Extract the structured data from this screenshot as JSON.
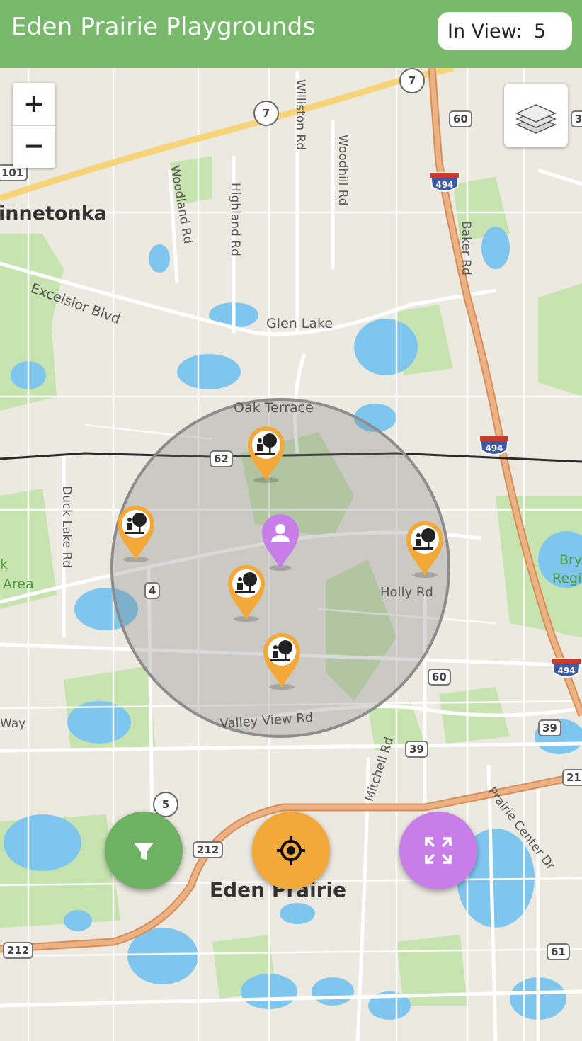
{
  "app": {
    "title": "Eden Prairie Playgrounds"
  },
  "in_view": {
    "label": "In View:",
    "count": "5"
  },
  "map_controls": {
    "zoom_in": "+",
    "zoom_out": "−"
  },
  "map_labels": {
    "innetonka": "innetonka",
    "eden_prairie": "Eden Prairie",
    "excelsior": "Excelsior Blvd",
    "glen_lake": "Glen Lake",
    "oak_terrace": "Oak Terrace",
    "holly": "Holly Rd",
    "valley_view": "Valley View Rd",
    "mitchell": "Mitchell Rd",
    "prairie_center": "Prairie Center Dr",
    "woodland": "Woodland Rd",
    "highland": "Highland Rd",
    "williston": "Williston Rd",
    "woodhill": "Woodhill Rd",
    "baker": "Baker Rd",
    "duck_lake": "Duck Lake Rd",
    "area_k": "k",
    "area": "Area",
    "way": "Way",
    "bry": "Bry",
    "regi": "Regi"
  },
  "shields": {
    "r7a": "7",
    "r7b": "7",
    "r60a": "60",
    "r101": "101",
    "r62": "62",
    "r4": "4",
    "r60b": "60",
    "r39a": "39",
    "r39b": "39",
    "r5": "5",
    "r212a": "212",
    "r212b": "212",
    "r61": "61",
    "r21": "21",
    "r3": "3",
    "i494a": "494",
    "i494b": "494",
    "i494c": "494"
  },
  "markers": {
    "playground_count": 5,
    "user_location": "user-marker"
  },
  "colors": {
    "header": "#78b96b",
    "playground_pin": "#f3a93a",
    "user_pin": "#c77ee8",
    "filter_fab": "#6fb263",
    "locate_fab": "#f3a93a",
    "expand_fab": "#c77ee8",
    "water": "#7dc4ec",
    "park": "#bfe0a5",
    "highway": "#e8b07e"
  },
  "icons": {
    "filter": "filter-icon",
    "locate": "crosshair-icon",
    "expand": "expand-icon",
    "layers": "layers-icon",
    "playground": "playground-icon",
    "user": "person-icon"
  }
}
